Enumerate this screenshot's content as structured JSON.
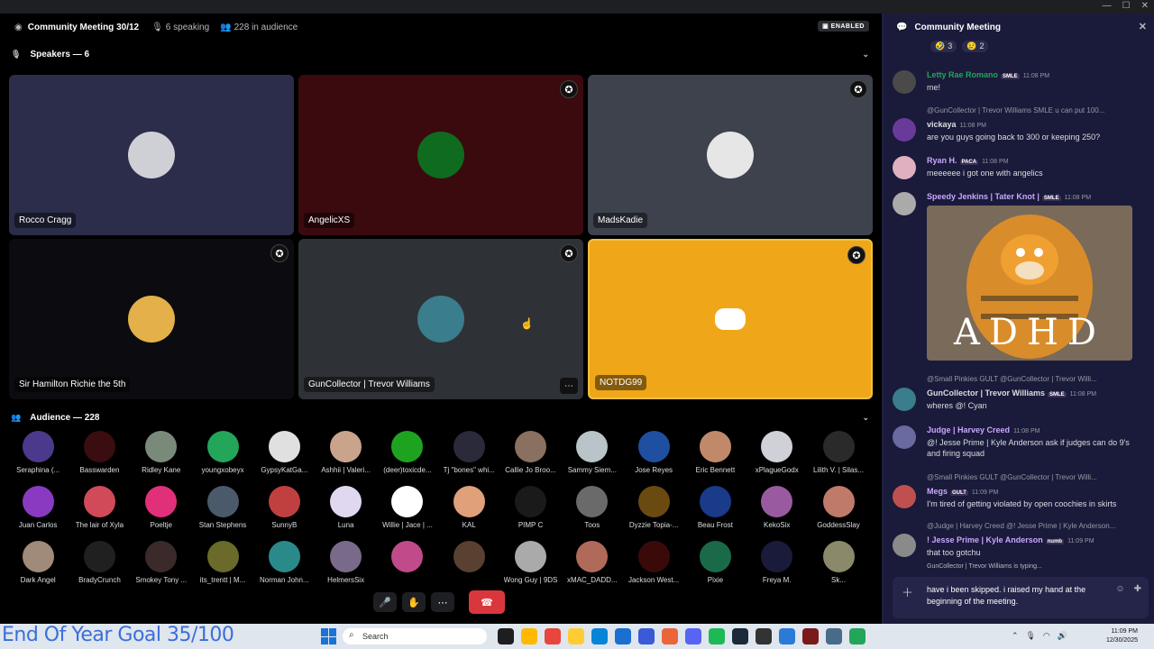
{
  "window": {
    "minimize": "—",
    "maximize": "☐",
    "close": "✕"
  },
  "stage": {
    "title": "Community Meeting 30/12",
    "speaking": "6 speaking",
    "audience_count": "228 in audience",
    "enabled": "ENABLED",
    "speakers_heading": "Speakers — 6",
    "audience_heading": "Audience — 228"
  },
  "speakers": [
    {
      "name": "Rocco Cragg",
      "bg": "#2b2d4a",
      "avatar": "#cfcfd6"
    },
    {
      "name": "AngelicXS",
      "bg": "#3a0a0f",
      "avatar": "#0f6b1e"
    },
    {
      "name": "MadsKadie",
      "bg": "#3d424d",
      "avatar": "#e6e6e6"
    },
    {
      "name": "Sir Hamilton Richie the 5th",
      "bg": "#0c0c10",
      "avatar": "#e3b04a"
    },
    {
      "name": "GunCollector | Trevor Williams",
      "bg": "#2e3236",
      "avatar": "#3a7d8c"
    },
    {
      "name": "NOTDG99",
      "bg": "#f0a619",
      "avatar": "#ffffff"
    }
  ],
  "audience": [
    {
      "name": "Seraphina (...",
      "c": "#4b3a8c"
    },
    {
      "name": "Basswarden",
      "c": "#3a0d10"
    },
    {
      "name": "Ridley Kane",
      "c": "#7a8a7a"
    },
    {
      "name": "youngxobeyx",
      "c": "#23a55a"
    },
    {
      "name": "GypsyKatGa...",
      "c": "#e0e0e0"
    },
    {
      "name": "Ashhii | Valeri...",
      "c": "#c9a38c"
    },
    {
      "name": "(deer)toxicde...",
      "c": "#1ea320"
    },
    {
      "name": "Tj \"bones\" whi...",
      "c": "#2a2a3a"
    },
    {
      "name": "Callie Jo Broo...",
      "c": "#8a7060"
    },
    {
      "name": "Sammy Siem...",
      "c": "#b8c4c8"
    },
    {
      "name": "Jose Reyes",
      "c": "#1e4fa0"
    },
    {
      "name": "Eric Bennett",
      "c": "#c08a6a"
    },
    {
      "name": "xPlagueGodx",
      "c": "#d0d0d8"
    },
    {
      "name": "Lilith V. | Silas...",
      "c": "#2a2a2a"
    },
    {
      "name": "Juan Carlos",
      "c": "#8a3ac0"
    },
    {
      "name": "The lair of Xyla",
      "c": "#d04a5a"
    },
    {
      "name": "Poeltje",
      "c": "#e0307a"
    },
    {
      "name": "Stan Stephens",
      "c": "#4a5a6a"
    },
    {
      "name": "SunnyB",
      "c": "#c04040"
    },
    {
      "name": "Luna",
      "c": "#e0d8f0"
    },
    {
      "name": "Willie | Jace | ...",
      "c": "#ffffff"
    },
    {
      "name": "KAL",
      "c": "#e0a07a"
    },
    {
      "name": "PIMP C",
      "c": "#1a1a1a"
    },
    {
      "name": "Toos",
      "c": "#6a6a6a"
    },
    {
      "name": "Dyzzie Topia-...",
      "c": "#6a4a10"
    },
    {
      "name": "Beau Frost",
      "c": "#1a3a8a"
    },
    {
      "name": "KekoSix",
      "c": "#9a5aa0"
    },
    {
      "name": "GoddessSlay",
      "c": "#c07a6a"
    },
    {
      "name": "Dark Angel",
      "c": "#a08a7a"
    },
    {
      "name": "BradyCrunch",
      "c": "#202020"
    },
    {
      "name": "Smokey Tony ...",
      "c": "#3a2a2a"
    },
    {
      "name": "its_trentt | M...",
      "c": "#6a6a2a"
    },
    {
      "name": "Norman John...",
      "c": "#2a8a8a"
    },
    {
      "name": "HelmersSix",
      "c": "#7a6a8a"
    },
    {
      "name": "",
      "c": "#c04a8a"
    },
    {
      "name": "",
      "c": "#5a4030"
    },
    {
      "name": "Wong Guy | 9DS",
      "c": "#aaaaaa"
    },
    {
      "name": "xMAC_DADD...",
      "c": "#b06a5a"
    },
    {
      "name": "Jackson West...",
      "c": "#3a0a0a"
    },
    {
      "name": "Pixie",
      "c": "#1a6a4a"
    },
    {
      "name": "Freya M.",
      "c": "#1a1a3a"
    },
    {
      "name": "Sk...",
      "c": "#8a8a6a"
    }
  ],
  "controls": {
    "mute": "🎤",
    "hand": "✋",
    "more": "⋯",
    "leave": "☎"
  },
  "chat": {
    "title": "Community Meeting",
    "reactions": [
      {
        "emoji": "🤣",
        "count": "3"
      },
      {
        "emoji": "😢",
        "count": "2"
      }
    ],
    "messages": [
      {
        "author": "Letty Rae Romano",
        "tag": "SMLE",
        "time": "11:08 PM",
        "text": "me!",
        "color": "#23a55a",
        "av": "#4a4a4a"
      },
      {
        "reply": "@GunCollector | Trevor Williams  SMLE  u can put 100...",
        "author": "vickaya",
        "tag": "",
        "time": "11:08 PM",
        "text": "are you guys going back to 300 or keeping 250?",
        "color": "#dbdee1",
        "av": "#6a3a9a"
      },
      {
        "author": "Ryan H.",
        "tag": "PACA",
        "time": "11:08 PM",
        "text": "meeeeee i got one with angelics",
        "color": "#c9a7ff",
        "av": "#e0b0c0"
      },
      {
        "author": "Speedy Jenkins | Tater Knot |",
        "tag": "SMLE",
        "time": "11:08 PM",
        "text": "",
        "color": "#c9a7ff",
        "av": "#aaaaaa"
      },
      {
        "reply": "@Small Pinkies  GULT  @GunCollector | Trevor Willi...",
        "author": "GunCollector | Trevor Williams",
        "tag": "SMLE",
        "time": "11:08 PM",
        "text": "wheres @! Cyan",
        "color": "#dbdee1",
        "av": "#3a7d8c"
      },
      {
        "author": "Judge | Harvey Creed",
        "tag": "",
        "time": "11:08 PM",
        "text": "@! Jesse Prime | Kyle Anderson  ask if judges can do 9's and firing squad",
        "color": "#c9a7ff",
        "av": "#6a6aa0"
      },
      {
        "reply": "@Small Pinkies  GULT  @GunCollector | Trevor Willi...",
        "author": "Megs",
        "tag": "GULT",
        "time": "11:09 PM",
        "text": "I'm tired of getting violated by open coochies in skirts",
        "color": "#c9a7ff",
        "av": "#c05050"
      },
      {
        "reply": "@Judge | Harvey Creed  @! Jesse Prime | Kyle Anderson...",
        "author": "! Jesse Prime | Kyle Anderson",
        "tag": "numb",
        "time": "11:09 PM",
        "text": "that too gotchu",
        "color": "#c9a7ff",
        "av": "#8a8a8a"
      }
    ],
    "gif_text": "ADHD",
    "typing": "GunCollector | Trevor Williams is typing...",
    "input_value": "have i been skipped. i raised my hand at the beginning of the meeting."
  },
  "overlay": {
    "goal": "End Of Year Goal 35/100"
  },
  "taskbar": {
    "search": "Search",
    "time": "11:09 PM",
    "date": "12/30/2025"
  }
}
